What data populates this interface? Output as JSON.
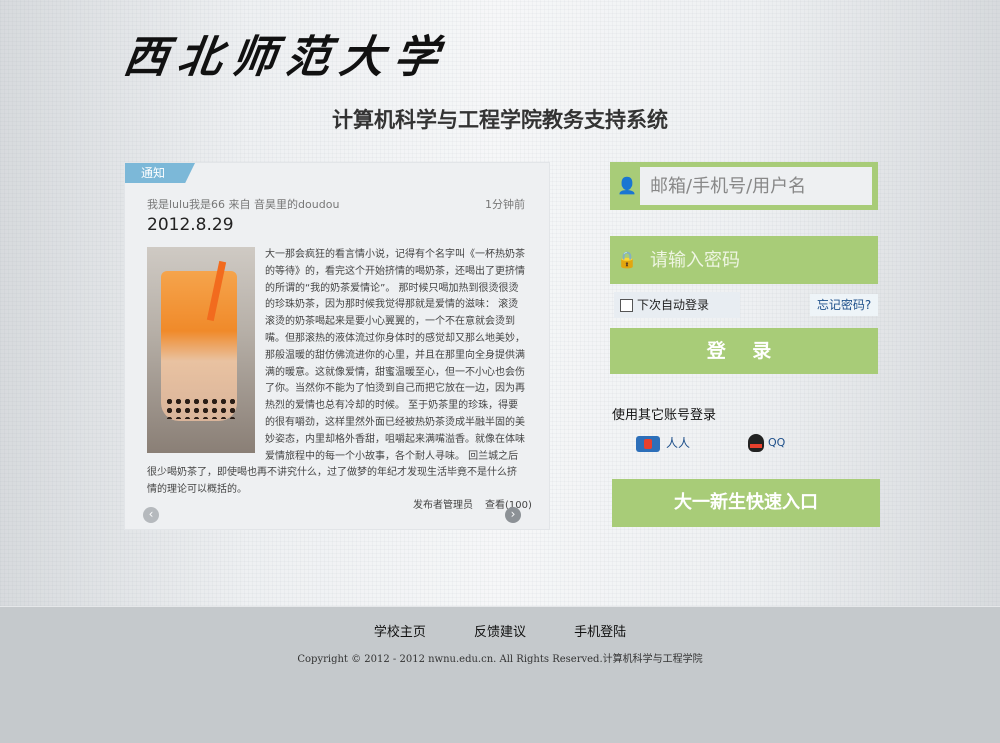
{
  "header": {
    "logo_text": "西北师范大学",
    "system_title": "计算机科学与工程学院教务支持系统"
  },
  "notice": {
    "tag": "通知",
    "author_line": "我是lulu我是66  来自 音昊里的doudou",
    "time_ago": "1分钟前",
    "date": "2012.8.29",
    "body": "大一那会疯狂的看言情小说，记得有个名字叫《一杯热奶茶的等待》的，看完这个开始挤情的喝奶茶，还喝出了更挤情的所谓的“我的奶茶爱情论”。  那时候只喝加热到很烫很烫的珍珠奶茶，因为那时候我觉得那就是爱情的滋味：  滚烫滚烫的奶茶喝起来是要小心翼翼的，一个不在意就会烫到嘴。但那滚热的液体流过你身体时的感觉却又那么地美妙，那般温暖的甜仿佛流进你的心里，并且在那里向全身提供满满的暖意。这就像爱情，甜蜜温暖至心，但一不小心也会伤了你。当然你不能为了怕烫到自己而把它放在一边，因为再热烈的爱情也总有冷却的时候。  至于奶茶里的珍珠，得要的很有嚼劲，这样里然外面已经被热奶茶烫成半融半固的美妙姿态，内里却格外香甜，咀嚼起来满嘴溢香。就像在体味爱情旅程中的每一个小故事，各个耐人寻味。  回兰城之后很少喝奶茶了，即使喝也再不讲究什么，过了做梦的年纪才发现生活毕竟不是什么挤情的理论可以概括的。",
    "posted_by": "发布者管理员",
    "views": "查看(100)"
  },
  "login": {
    "username_placeholder": "邮箱/手机号/用户名",
    "password_placeholder": "请输入密码",
    "remember_label": "下次自动登录",
    "forgot_label": "忘记密码?",
    "login_button": "登 录",
    "other_accounts_title": "使用其它账号登录",
    "renren_label": "人人",
    "qq_label": "QQ",
    "freshman_button": "大一新生快速入口"
  },
  "footer": {
    "links": [
      "学校主页",
      "反馈建议",
      "手机登陆"
    ],
    "copyright": "Copyright © 2012 - 2012 nwnu.edu.cn. All Rights Reserved.计算机科学与工程学院"
  }
}
